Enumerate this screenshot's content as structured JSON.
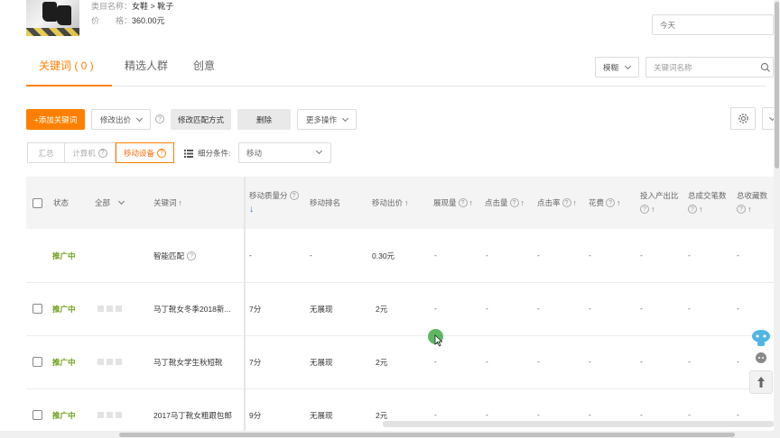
{
  "product": {
    "category_label": "类目名称：",
    "category_value": "女鞋 > 靴子",
    "price_label": "价　　格：",
    "price_value": "360.00元"
  },
  "date_select": {
    "value": "今天"
  },
  "tabs": [
    {
      "label": "关键词 ( 0 )",
      "active": true
    },
    {
      "label": "精选人群",
      "active": false
    },
    {
      "label": "创意",
      "active": false
    }
  ],
  "search": {
    "match_mode": "模糊",
    "placeholder": "关键词名称"
  },
  "toolbar": {
    "add_keyword": "+添加关键词",
    "modify_bid": "修改出价",
    "modify_match": "修改匹配方式",
    "delete": "删除",
    "more_actions": "更多操作"
  },
  "segments": [
    {
      "label": "汇总",
      "help": false,
      "active": false
    },
    {
      "label": "计算机",
      "help": true,
      "active": false
    },
    {
      "label": "移动设备",
      "help": true,
      "active": true
    }
  ],
  "filter": {
    "label": "细分条件:",
    "value": "移动"
  },
  "columns": {
    "status": "状态",
    "all": "全部",
    "keyword": "关键词",
    "mobile_quality": "移动质量分",
    "mobile_rank": "移动排名",
    "mobile_bid": "移动出价",
    "impressions": "展现量",
    "clicks": "点击量",
    "ctr": "点击率",
    "cost": "花费",
    "roi": "投入产出比",
    "total_orders": "总成交笔数",
    "total_favs": "总收藏数"
  },
  "rows": [
    {
      "checkbox": false,
      "status": "推广中",
      "blocks": false,
      "keyword": "智能匹配",
      "help": true,
      "quality": "-",
      "rank": "-",
      "bid": "0.30元",
      "metrics": [
        "-",
        "-",
        "-",
        "-",
        "-",
        "-",
        "-"
      ]
    },
    {
      "checkbox": true,
      "status": "推广中",
      "blocks": true,
      "keyword": "马丁靴女冬季2018新...",
      "help": false,
      "quality": "7分",
      "rank": "无展现",
      "bid": "2元",
      "metrics": [
        "-",
        "-",
        "-",
        "-",
        "-",
        "-",
        "-"
      ]
    },
    {
      "checkbox": true,
      "status": "推广中",
      "blocks": true,
      "keyword": "马丁靴女学生秋短靴",
      "help": false,
      "quality": "7分",
      "rank": "无展现",
      "bid": "2元",
      "metrics": [
        "-",
        "-",
        "-",
        "-",
        "-",
        "-",
        "-"
      ]
    },
    {
      "checkbox": true,
      "status": "推广中",
      "blocks": true,
      "keyword": "2017马丁靴女粗跟包邮",
      "help": false,
      "quality": "9分",
      "rank": "无展现",
      "bid": "2元",
      "metrics": [
        "-",
        "-",
        "-",
        "-",
        "-",
        "-",
        "-"
      ]
    }
  ],
  "colors": {
    "accent": "#ff8000",
    "status_green": "#6a9d14"
  }
}
